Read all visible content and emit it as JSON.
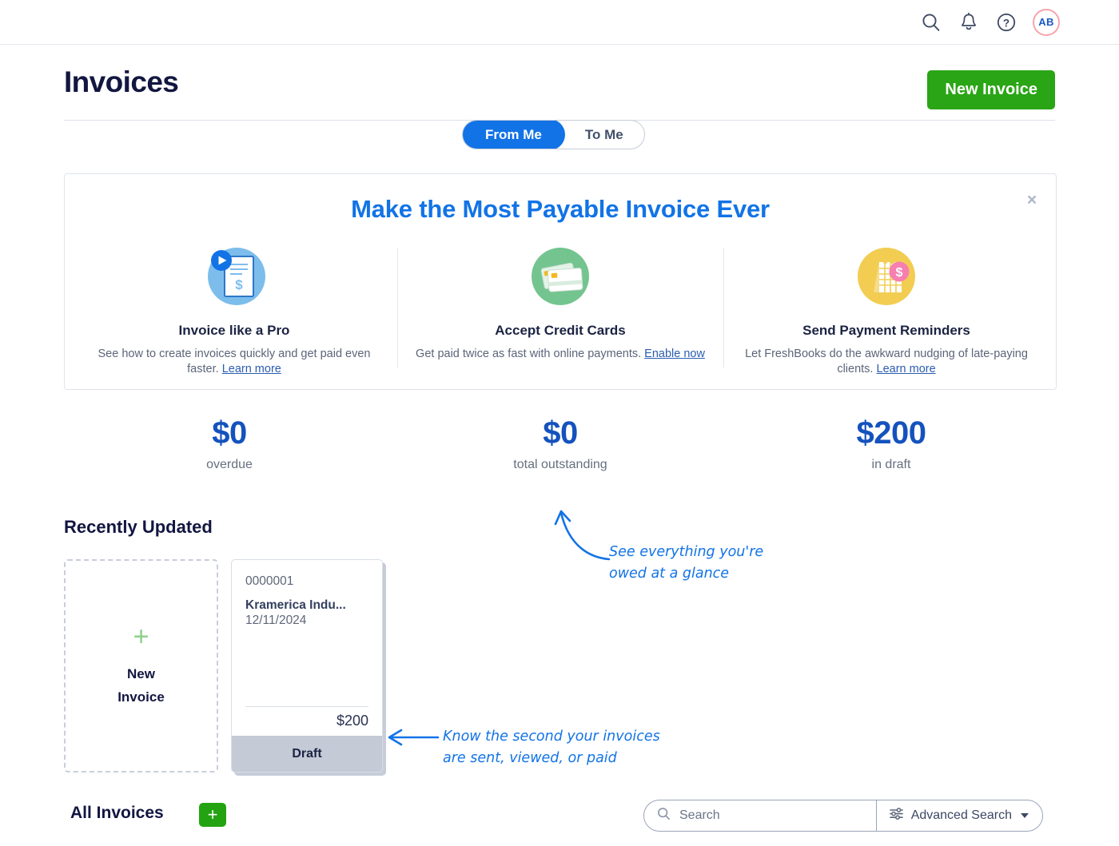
{
  "topbar": {
    "icons": [
      {
        "name": "search-icon",
        "label": "Search"
      },
      {
        "name": "notifications-bell-icon",
        "label": "Notifications"
      },
      {
        "name": "help-icon",
        "label": "Help"
      }
    ],
    "avatar_initials": "AB"
  },
  "header": {
    "title": "Invoices",
    "new_invoice_label": "New Invoice",
    "toggle": {
      "options": [
        "From Me",
        "To Me"
      ],
      "selected": "From Me"
    }
  },
  "banner": {
    "title": "Make the Most Payable Invoice Ever",
    "close_label": "×",
    "features": [
      {
        "icon": "invoice-video-icon",
        "title": "Invoice like a Pro",
        "desc": "See how to create invoices quickly and get paid even faster. ",
        "link": "Learn more"
      },
      {
        "icon": "credit-cards-icon",
        "title": "Accept Credit Cards",
        "desc": "Get paid twice as fast with online payments. ",
        "link": "Enable now"
      },
      {
        "icon": "calendar-reminder-icon",
        "title": "Send Payment Reminders",
        "desc": "Let FreshBooks do the awkward nudging of late-paying clients. ",
        "link": "Learn more"
      }
    ]
  },
  "stats": [
    {
      "value": "$0",
      "label": "overdue"
    },
    {
      "value": "$0",
      "label": "total outstanding"
    },
    {
      "value": "$200",
      "label": "in draft"
    }
  ],
  "recently_updated": {
    "title": "Recently Updated",
    "new_card": {
      "plus": "+",
      "label": "New\nInvoice"
    },
    "invoice": {
      "number": "0000001",
      "client": "Kramerica Indu...",
      "date": "12/11/2024",
      "total": "$200",
      "status": "Draft"
    }
  },
  "annotations": [
    {
      "name": "annotation-outstanding",
      "text": "See everything you're owed at a glance"
    },
    {
      "name": "annotation-status",
      "text": "Know the second your invoices are sent, viewed, or paid"
    }
  ],
  "all_invoices": {
    "title": "All Invoices",
    "add_label": "+",
    "search_placeholder": "Search",
    "search_value": "",
    "advanced_search_label": "Advanced Search"
  },
  "colors": {
    "accent_blue": "#1273e6",
    "green": "#2aa515",
    "navy": "#121640",
    "stat_blue": "#1452bd",
    "status_gray": "#c4cad6"
  }
}
